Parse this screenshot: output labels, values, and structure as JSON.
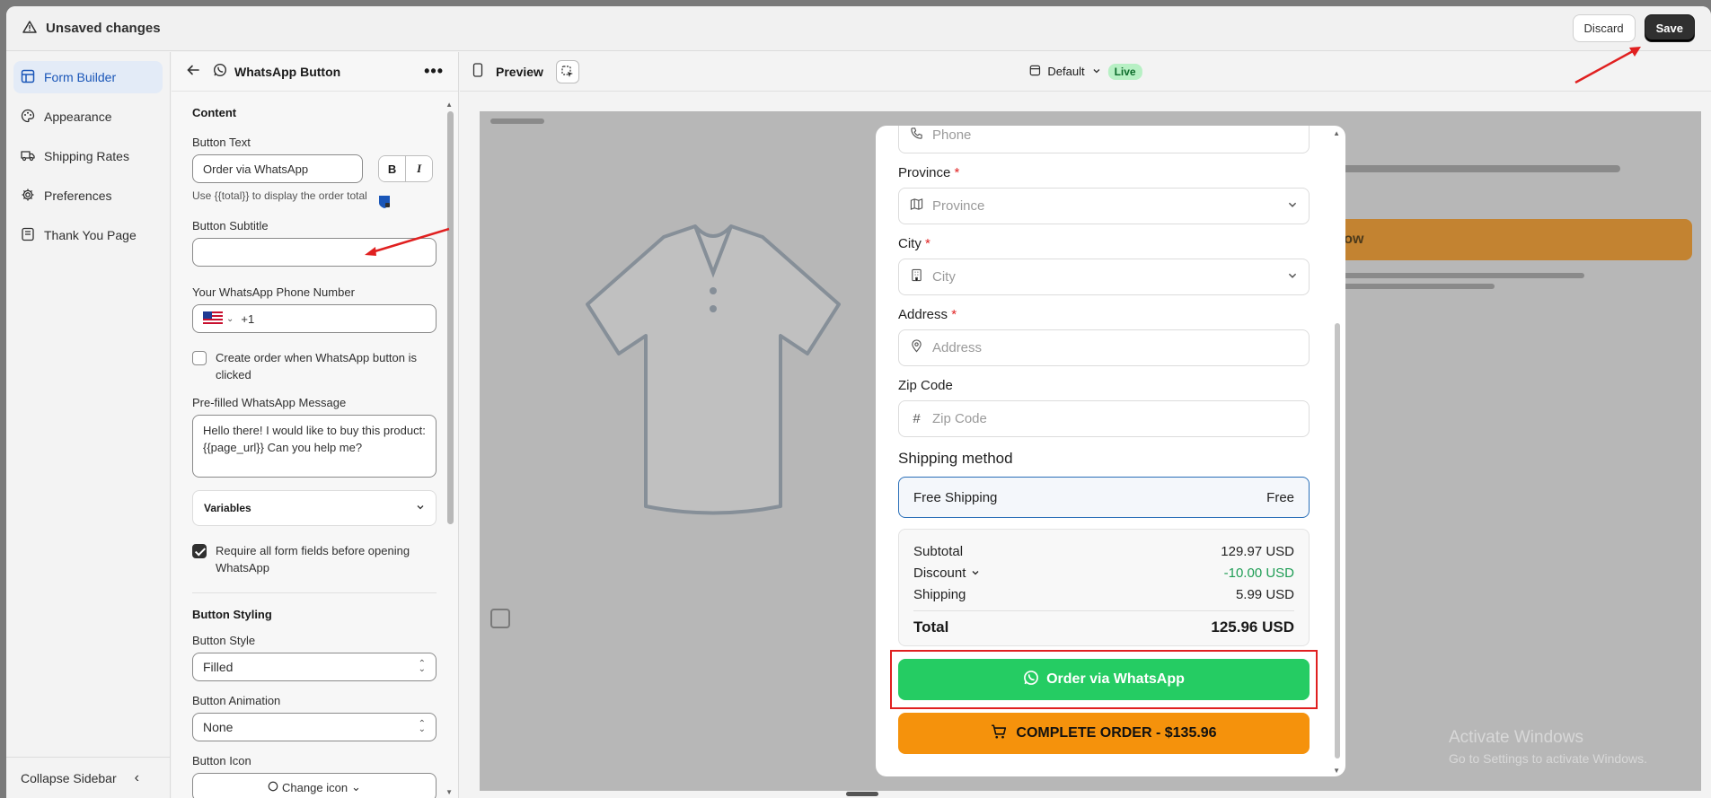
{
  "topbar": {
    "title": "Unsaved changes",
    "discard_label": "Discard",
    "save_label": "Save"
  },
  "sidebar": {
    "items": [
      {
        "label": "Form Builder",
        "icon": "layout-icon",
        "active": true
      },
      {
        "label": "Appearance",
        "icon": "palette-icon"
      },
      {
        "label": "Shipping Rates",
        "icon": "truck-icon"
      },
      {
        "label": "Preferences",
        "icon": "gear-icon"
      },
      {
        "label": "Thank You Page",
        "icon": "page-icon"
      }
    ],
    "collapse_label": "Collapse Sidebar"
  },
  "panel": {
    "title": "WhatsApp Button",
    "content_heading": "Content",
    "button_text_label": "Button Text",
    "button_text_value": "Order via WhatsApp",
    "bold_label": "B",
    "italic_label": "I",
    "help_text": "Use {{total}} to display the order total",
    "subtitle_label": "Button Subtitle",
    "subtitle_value": "",
    "phone_label": "Your WhatsApp Phone Number",
    "phone_value": "+1",
    "create_order_label": "Create order when WhatsApp button is clicked",
    "create_order_checked": false,
    "message_label": "Pre-filled WhatsApp Message",
    "message_value": "Hello there! I would like to buy this product: {{page_url}} Can you help me?",
    "variables_label": "Variables",
    "require_fields_label": "Require all form fields before opening WhatsApp",
    "require_fields_checked": true,
    "styling_heading": "Button Styling",
    "style_label": "Button Style",
    "style_value": "Filled",
    "animation_label": "Button Animation",
    "animation_value": "None",
    "icon_label": "Button Icon",
    "change_icon_label": "Change icon"
  },
  "preview": {
    "label": "Preview",
    "theme": "Default",
    "status": "Live",
    "background_button": "r Now",
    "form": {
      "phone_placeholder": "Phone",
      "province_label": "Province",
      "province_placeholder": "Province",
      "city_label": "City",
      "city_placeholder": "City",
      "address_label": "Address",
      "address_placeholder": "Address",
      "zip_label": "Zip Code",
      "zip_placeholder": "Zip Code",
      "shipping_heading": "Shipping method",
      "shipping_option": "Free Shipping",
      "shipping_price": "Free",
      "subtotal_label": "Subtotal",
      "subtotal_value": "129.97 USD",
      "discount_label": "Discount",
      "discount_value": "-10.00 USD",
      "shipping_label": "Shipping",
      "shipping_value": "5.99 USD",
      "total_label": "Total",
      "total_value": "125.96 USD",
      "whatsapp_button": "Order via WhatsApp",
      "complete_button": "COMPLETE ORDER - $135.96"
    }
  },
  "watermark": {
    "line1": "Activate Windows",
    "line2": "Go to Settings to activate Windows."
  },
  "colors": {
    "accent": "#1a56b8",
    "whatsapp": "#25cc63",
    "complete": "#f5920c",
    "highlight": "#e02020"
  }
}
